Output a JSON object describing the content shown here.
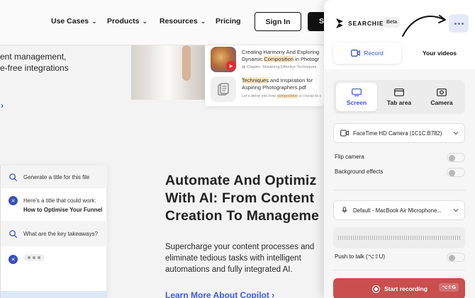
{
  "site": {
    "nav": {
      "use_cases": "Use Cases",
      "products": "Products",
      "resources": "Resources",
      "pricing": "Pricing",
      "sign_in": "Sign In",
      "sign_up_partial": "S"
    },
    "hero_lines": [
      "ent management,",
      "e-free integrations"
    ],
    "files": [
      {
        "title1": "Creating Harmony And Exploring",
        "title2_pre": "Dynamic ",
        "title2_hl": "Composition",
        "title2_post": " in Photogr",
        "sub_pre": "Chapter: Mastering Effective ",
        "sub_hl": "Techniques"
      },
      {
        "title1_hl": "Techniques",
        "title1_post": " and Inspiration for",
        "title2": "Aspiring Photographers.pdf",
        "sub_pre": "Let's delve into how ",
        "sub_hl": "composition",
        "sub_post": " is crucial to c"
      }
    ],
    "chat": {
      "q1": "Generate a title for this file",
      "a1_line1": "Here's a title that could work:",
      "a1_line2": "How to Optimise Your Funnel",
      "q2": "What are the key takeaways?"
    },
    "headline": [
      "Automate And Optimiz",
      "With AI: From Content",
      "Creation To Manageme"
    ],
    "paragraph": [
      "Supercharge your content processes and",
      "eliminate tedious tasks with intelligent",
      "automations and fully integrated AI."
    ],
    "learn_more": "Learn More About Copilot"
  },
  "panel": {
    "brand": "SEARCHIE",
    "beta": "Beta",
    "tabs": {
      "record": "Record",
      "videos": "Your videos"
    },
    "sources": {
      "screen": "Screen",
      "tab_area": "Tab area",
      "camera": "Camera"
    },
    "camera_device": "FaceTime HD Camera (1C1C:B782)",
    "flip_camera": "Flip camera",
    "background_effects": "Background effects",
    "microphone": "Default - MacBook Air Microphone...",
    "push_to_talk": "Push to talk (⌥⇧U)",
    "start_recording": "Start recording",
    "start_shortcut": "⌥⇧G",
    "accent": "#3a55cf",
    "record_color": "#c94f4f"
  }
}
